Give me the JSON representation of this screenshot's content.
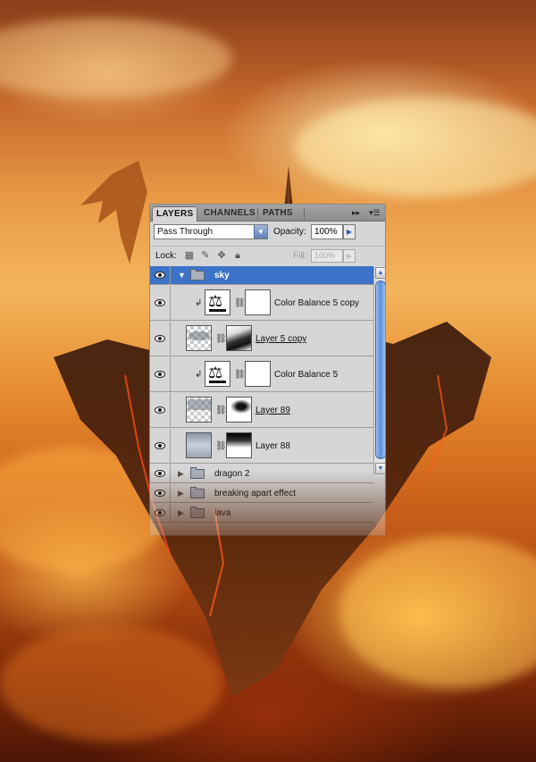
{
  "panel": {
    "tabs": [
      "LAYERS",
      "CHANNELS",
      "PATHS"
    ],
    "menu_icon": "panel-menu-icon",
    "blend_mode": "Pass Through",
    "opacity_label": "Opacity:",
    "opacity_value": "100%",
    "lock_label": "Lock:",
    "fill_label": "Fill:",
    "fill_value": "100%"
  },
  "layers": [
    {
      "type": "group",
      "name": "sky",
      "expanded": true,
      "selected": true,
      "visible": true
    },
    {
      "type": "adjustment",
      "name": "Color Balance 5 copy",
      "clipped": true,
      "visible": true
    },
    {
      "type": "pixel",
      "name": "Layer 5 copy",
      "underlined": true,
      "visible": true
    },
    {
      "type": "adjustment",
      "name": "Color Balance 5",
      "clipped": true,
      "visible": true
    },
    {
      "type": "pixel",
      "name": "Layer 89",
      "underlined": true,
      "visible": true
    },
    {
      "type": "pixel",
      "name": "Layer 88",
      "underlined": false,
      "visible": true
    },
    {
      "type": "group",
      "name": "dragon 2",
      "expanded": false,
      "visible": true
    },
    {
      "type": "group",
      "name": "breaking apart effect",
      "expanded": false,
      "visible": true
    },
    {
      "type": "group",
      "name": "lava",
      "expanded": false,
      "visible": true
    }
  ],
  "colors": {
    "selection": "#3c73c8",
    "panel_bg": "#d6d6d6"
  }
}
